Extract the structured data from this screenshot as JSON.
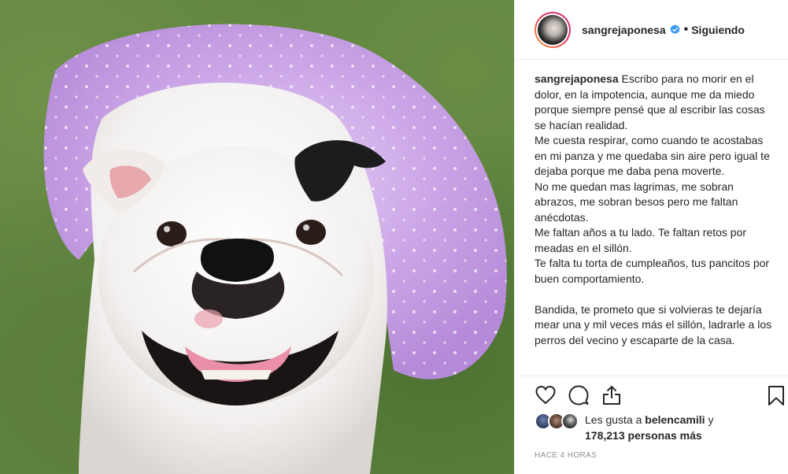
{
  "post": {
    "username": "sangrejaponesa",
    "follow_label": "Siguiendo",
    "separator": "•",
    "caption_user": "sangrejaponesa",
    "caption_lines": [
      "Escribo para no morir en el dolor, en la impotencia, aunque me da miedo porque siempre pensé que al escribir las cosas se hacían realidad.",
      "Me cuesta respirar, como cuando te acostabas en mi panza y me quedaba sin aire pero igual te dejaba porque me daba pena moverte.",
      "No me quedan mas lagrimas, me sobran abrazos, me sobran besos pero me faltan anécdotas.",
      "Me faltan años a tu lado. Te faltan retos por meadas en el sillón.",
      "Te falta tu torta de cumpleaños, tus pancitos por buen comportamiento.",
      "",
      "Bandida, te prometo que si volvieras te dejaría mear una y mil veces más el sillón, ladrarle a los perros del vecino y escaparte de la casa."
    ],
    "likes_prefix": "Les gusta a",
    "likes_user": "belencamili",
    "likes_conj": "y",
    "likes_count": "178,213",
    "likes_suffix": "personas más",
    "timestamp": "HACE 4 HORAS"
  },
  "icons": {
    "like": "heart-icon",
    "comment": "comment-icon",
    "share": "share-icon",
    "save": "bookmark-icon",
    "verified": "verified-badge-icon"
  },
  "colors": {
    "text": "#262626",
    "muted": "#8e8e8e",
    "verified": "#3897f0",
    "border": "#efefef"
  }
}
